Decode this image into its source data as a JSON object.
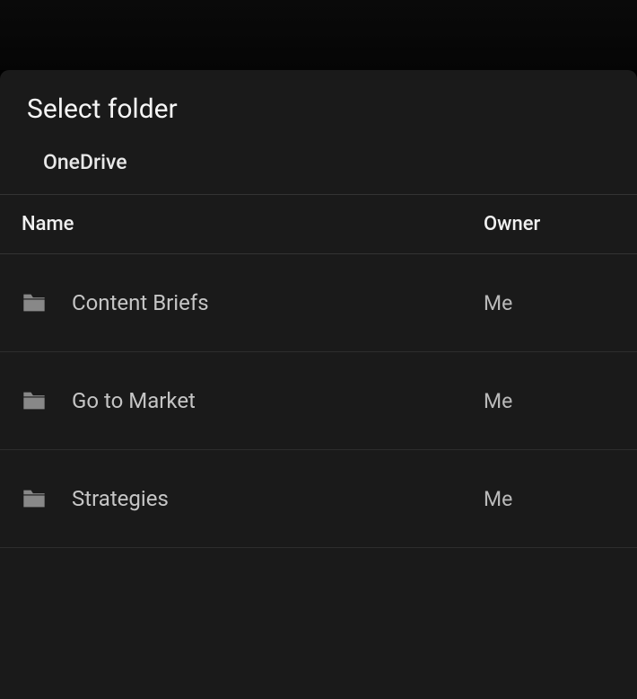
{
  "title": "Select folder",
  "breadcrumb": "OneDrive",
  "columns": {
    "name": "Name",
    "owner": "Owner"
  },
  "folders": [
    {
      "name": "Content Briefs",
      "owner": "Me"
    },
    {
      "name": "Go to Market",
      "owner": "Me"
    },
    {
      "name": "Strategies",
      "owner": "Me"
    }
  ]
}
